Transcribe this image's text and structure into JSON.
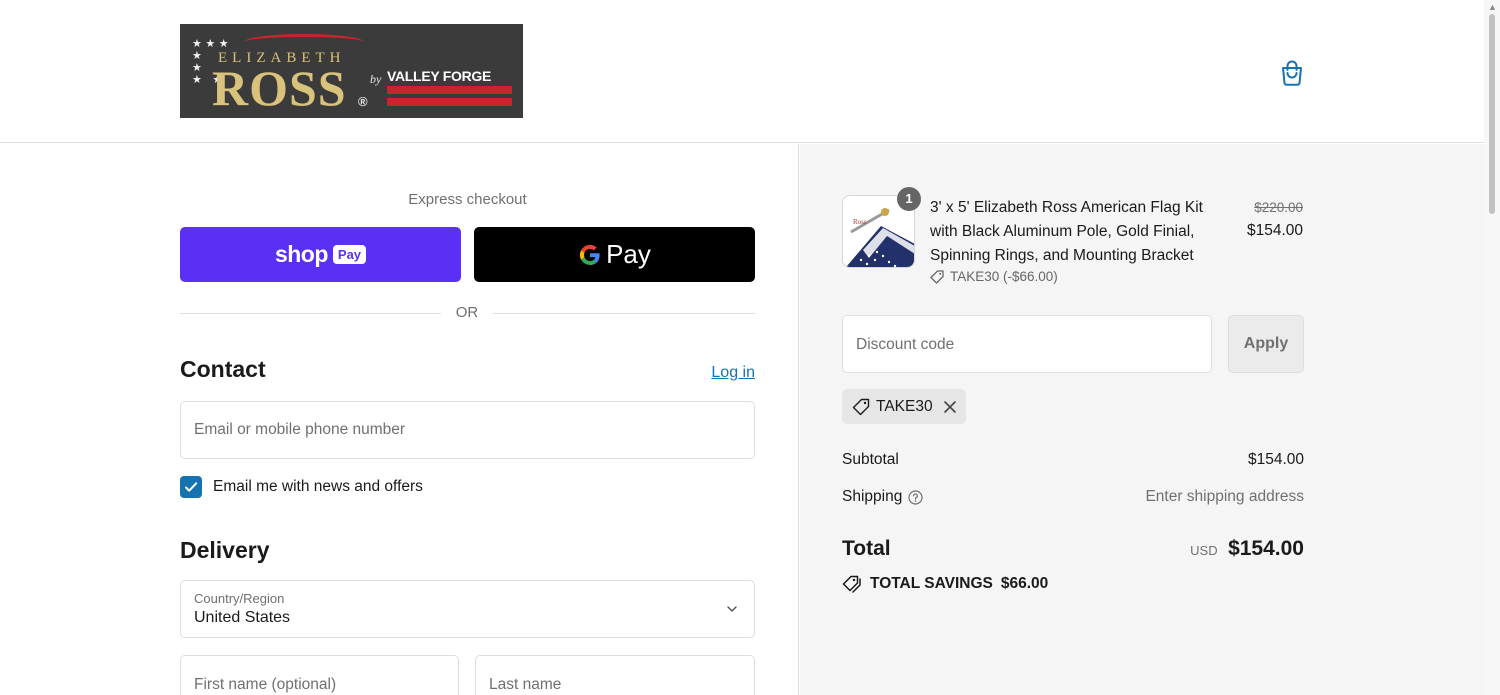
{
  "brand": {
    "logo_line1": "ELIZABETH",
    "logo_line2": "ROSS",
    "logo_reg": "®",
    "logo_by": "by",
    "logo_partner": "VALLEY FORGE"
  },
  "header": {
    "cart_icon": "shopping-bag-icon"
  },
  "express": {
    "title": "Express checkout",
    "shop_pay_word": "shop",
    "shop_pay_badge": "Pay",
    "gpay_word": "Pay",
    "separator": "OR"
  },
  "contact": {
    "title": "Contact",
    "login_link": "Log in",
    "email_placeholder": "Email or mobile phone number",
    "newsletter_label": "Email me with news and offers",
    "newsletter_checked": true
  },
  "delivery": {
    "title": "Delivery",
    "country_label": "Country/Region",
    "country_value": "United States",
    "first_name_placeholder": "First name (optional)",
    "last_name_placeholder": "Last name"
  },
  "order": {
    "item": {
      "quantity": "1",
      "name": "3' x 5' Elizabeth Ross American Flag Kit with Black Aluminum Pole, Gold Finial, Spinning Rings, and Mounting Bracket",
      "discount": "TAKE30 (-$66.00)",
      "original_price": "$220.00",
      "price": "$154.00"
    },
    "discount_placeholder": "Discount code",
    "apply_label": "Apply",
    "applied_code": "TAKE30",
    "subtotal_label": "Subtotal",
    "subtotal_value": "$154.00",
    "shipping_label": "Shipping",
    "shipping_value": "Enter shipping address",
    "total_label": "Total",
    "total_currency": "USD",
    "total_value": "$154.00",
    "savings_label": "TOTAL SAVINGS",
    "savings_value": "$66.00"
  },
  "colors": {
    "accent_link": "#1773b0",
    "shop_pay": "#5a31f4",
    "summary_bg": "#f5f5f5"
  }
}
